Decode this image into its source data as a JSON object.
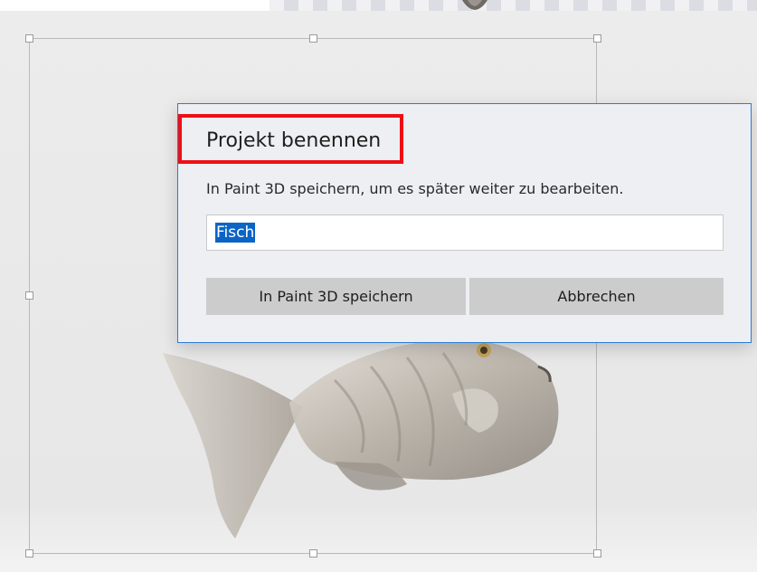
{
  "dialog": {
    "title": "Projekt benennen",
    "message": "In Paint 3D speichern, um es später weiter zu bearbeiten.",
    "name_input": {
      "value": "Fisch"
    },
    "save_label": "In Paint 3D speichern",
    "cancel_label": "Abbrechen"
  },
  "colors": {
    "accent_border": "#2b7cd3",
    "highlight_box": "#ee0f16",
    "text_selection": "#0a64c5",
    "button_bg": "#cccccc",
    "dialog_bg": "#eeeff2"
  },
  "icons": {
    "canvas_object": "fish-3d-model",
    "selection_handles": "resize-handle"
  }
}
